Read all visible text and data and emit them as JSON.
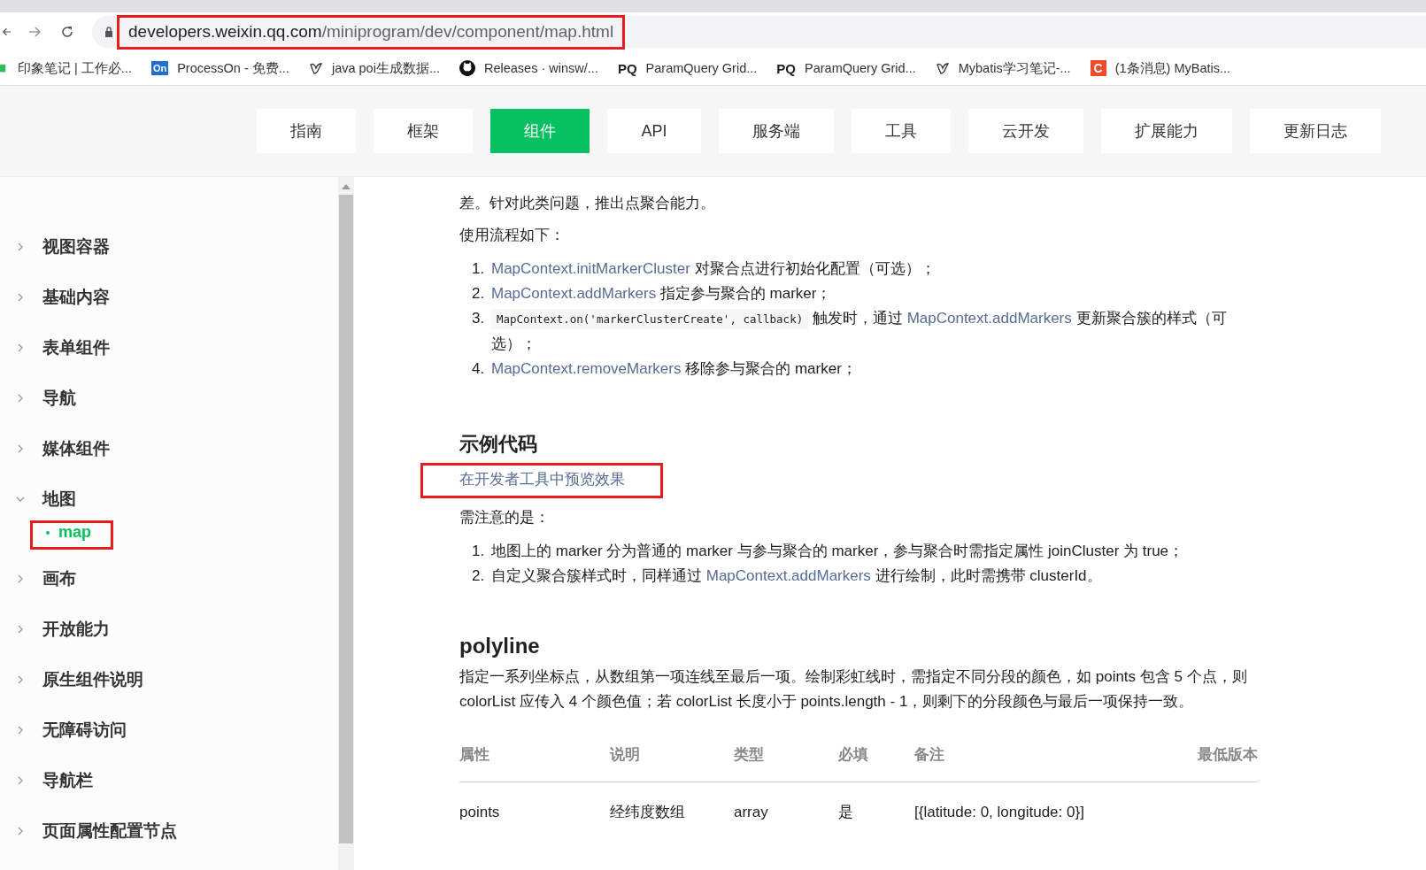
{
  "browser": {
    "address": {
      "host": "developers.weixin.qq.com",
      "path": "/miniprogram/dev/component/map.html",
      "highlighted": true
    },
    "bookmarks": [
      {
        "label": "印象笔记 | 工作必...",
        "kind": "note"
      },
      {
        "label": "ProcessOn - 免费...",
        "kind": "badge",
        "icon_text": "On"
      },
      {
        "label": "java poi生成数据...",
        "kind": "bird"
      },
      {
        "label": "Releases · winsw/...",
        "kind": "cat"
      },
      {
        "label": "ParamQuery Grid...",
        "kind": "letters",
        "icon_text": "PQ"
      },
      {
        "label": "ParamQuery Grid...",
        "kind": "letters",
        "icon_text": "PQ"
      },
      {
        "label": "Mybatis学习笔记-...",
        "kind": "bird"
      },
      {
        "label": "(1条消息) MyBatis...",
        "kind": "badge-red",
        "icon_text": "C"
      }
    ]
  },
  "nav": [
    {
      "label": "指南",
      "selected": false
    },
    {
      "label": "框架",
      "selected": false
    },
    {
      "label": "组件",
      "selected": true
    },
    {
      "label": "API",
      "selected": false
    },
    {
      "label": "服务端",
      "selected": false
    },
    {
      "label": "工具",
      "selected": false
    },
    {
      "label": "云开发",
      "selected": false
    },
    {
      "label": "扩展能力",
      "selected": false
    },
    {
      "label": "更新日志",
      "selected": false
    }
  ],
  "sidebar": {
    "items": [
      {
        "label": "视图容器",
        "expanded": false
      },
      {
        "label": "基础内容",
        "expanded": false
      },
      {
        "label": "表单组件",
        "expanded": false
      },
      {
        "label": "导航",
        "expanded": false
      },
      {
        "label": "媒体组件",
        "expanded": false
      },
      {
        "label": "地图",
        "expanded": true,
        "children": [
          {
            "label": "map",
            "selected": true,
            "highlighted": true
          }
        ]
      },
      {
        "label": "画布",
        "expanded": false
      },
      {
        "label": "开放能力",
        "expanded": false
      },
      {
        "label": "原生组件说明",
        "expanded": false
      },
      {
        "label": "无障碍访问",
        "expanded": false
      },
      {
        "label": "导航栏",
        "expanded": false
      },
      {
        "label": "页面属性配置节点",
        "expanded": false
      }
    ]
  },
  "content": {
    "intro": "差。针对此类问题，推出点聚合能力。",
    "usage_label": "使用流程如下：",
    "usage_steps": [
      {
        "number": "1.",
        "segments": [
          {
            "kind": "link",
            "text": "MapContext.initMarkerCluster"
          },
          {
            "kind": "text",
            "text": " 对聚合点进行初始化配置（可选）；"
          }
        ]
      },
      {
        "number": "2.",
        "segments": [
          {
            "kind": "link",
            "text": "MapContext.addMarkers"
          },
          {
            "kind": "text",
            "text": " 指定参与聚合的 marker；"
          }
        ]
      },
      {
        "number": "3.",
        "segments": [
          {
            "kind": "code",
            "text": "MapContext.on('markerClusterCreate', callback)"
          },
          {
            "kind": "text",
            "text": " 触发时，通过 "
          },
          {
            "kind": "link",
            "text": "MapContext.addMarkers"
          },
          {
            "kind": "text",
            "text": " 更新聚合簇的样式（可选）；"
          }
        ]
      },
      {
        "number": "4.",
        "segments": [
          {
            "kind": "link",
            "text": "MapContext.removeMarkers"
          },
          {
            "kind": "text",
            "text": " 移除参与聚合的 marker；"
          }
        ]
      }
    ],
    "example_heading": "示例代码",
    "preview_link": {
      "text": "在开发者工具中预览效果",
      "highlighted": true
    },
    "notes_label": "需注意的是：",
    "notes": [
      {
        "number": "1.",
        "segments": [
          {
            "kind": "text",
            "text": "地图上的 marker 分为普通的 marker 与参与聚合的 marker，参与聚合时需指定属性 joinCluster 为 true；"
          }
        ]
      },
      {
        "number": "2.",
        "segments": [
          {
            "kind": "text",
            "text": "自定义聚合簇样式时，同样通过 "
          },
          {
            "kind": "link",
            "text": "MapContext.addMarkers"
          },
          {
            "kind": "text",
            "text": " 进行绘制，此时需携带 clusterId。"
          }
        ]
      }
    ],
    "polyline_heading": "polyline",
    "polyline_text": "指定一系列坐标点，从数组第一项连线至最后一项。绘制彩虹线时，需指定不同分段的颜色，如 points 包含 5 个点，则 colorList 应传入 4 个颜色值；若 colorList 长度小于 points.length - 1，则剩下的分段颜色与最后一项保持一致。",
    "table": {
      "columns": [
        "属性",
        "说明",
        "类型",
        "必填",
        "备注",
        "最低版本"
      ],
      "rows": [
        [
          "points",
          "经纬度数组",
          "array",
          "是",
          "[{latitude: 0, longitude: 0}]"
        ]
      ]
    }
  }
}
